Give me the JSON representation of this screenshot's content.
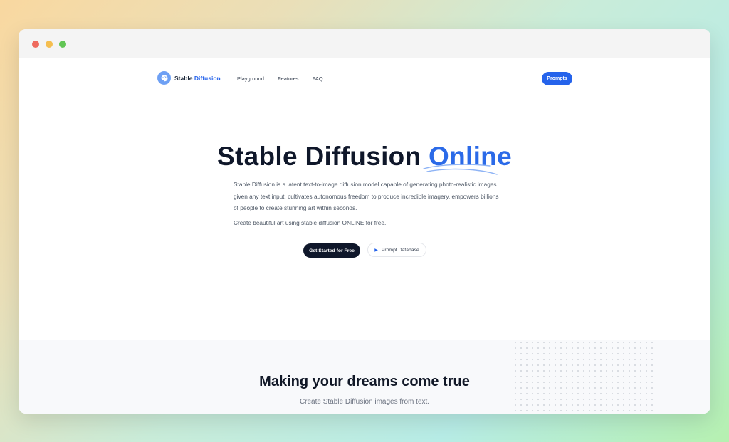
{
  "nav": {
    "brand_primary": "Stable",
    "brand_accent": "Diffusion",
    "links": [
      "Playground",
      "Features",
      "FAQ"
    ],
    "prompts_button": "Prompts"
  },
  "hero": {
    "title_main": "Stable Diffusion",
    "title_accent": "Online",
    "description": "Stable Diffusion is a latent text-to-image diffusion model capable of generating photo-realistic images given any text input, cultivates autonomous freedom to produce incredible imagery, empowers billions of people to create stunning art within seconds.",
    "free_line": "Create beautiful art using stable diffusion ONLINE for free.",
    "cta_primary": "Get Started for Free",
    "cta_secondary": "Prompt Database"
  },
  "section2": {
    "title": "Making your dreams come true",
    "subtitle": "Create Stable Diffusion images from text."
  },
  "colors": {
    "accent": "#2563eb",
    "dark": "#0f172a"
  },
  "icons": {
    "logo": "palette-icon",
    "play": "play-icon"
  }
}
